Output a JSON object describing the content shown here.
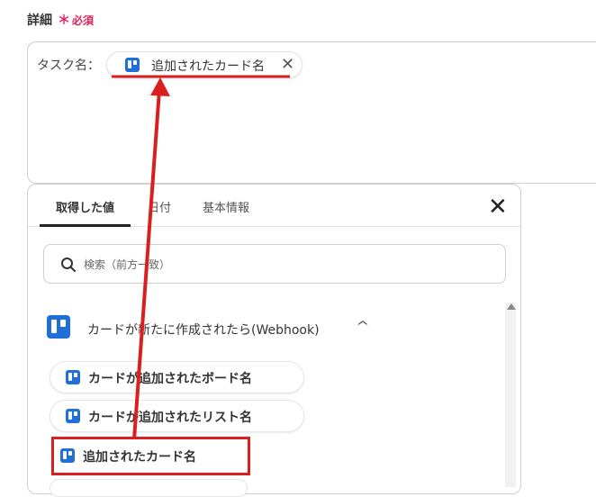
{
  "field": {
    "label": "詳細",
    "required_mark": "＊",
    "required_text": "必須"
  },
  "task": {
    "label": "タスク名："
  },
  "chip": {
    "text": "追加されたカード名",
    "close_glyph": "✕",
    "icon": "trello-icon"
  },
  "tabs": [
    {
      "label": "取得した値",
      "active": true
    },
    {
      "label": "日付",
      "active": false
    },
    {
      "label": "基本情報",
      "active": false
    }
  ],
  "panel": {
    "close_glyph": "✕"
  },
  "search": {
    "placeholder": "検索（前方一致）",
    "icon": "search-icon"
  },
  "group": {
    "title": "カードが新たに作成されたら(Webhook)",
    "caret": "^",
    "icon": "trello-icon"
  },
  "items": [
    {
      "label": "カードが追加されたボード名"
    },
    {
      "label": "カードが追加されたリスト名"
    },
    {
      "label": "追加されたカード名"
    }
  ],
  "colors": {
    "accent_red": "#d91f1f",
    "trello_blue": "#1f6fd6",
    "required_pink": "#e0245e"
  }
}
